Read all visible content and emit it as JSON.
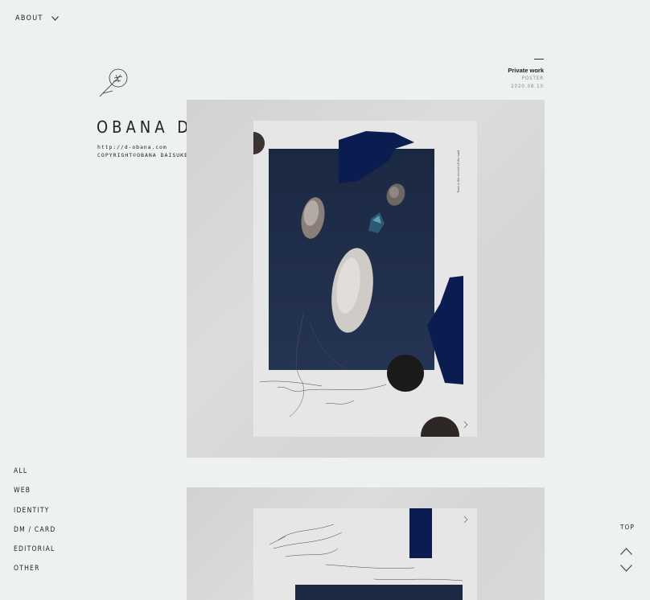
{
  "header": {
    "about_label": "ABOUT"
  },
  "profile": {
    "name": "OBANA DAISUKE",
    "url": "http://d-obana.com",
    "copyright": "COPYRIGHT©OBANA DAISUKE"
  },
  "work": {
    "title": "Private work",
    "category": "POSTER",
    "date": "2020.08.10"
  },
  "nav": {
    "items": [
      {
        "label": "ALL"
      },
      {
        "label": "WEB"
      },
      {
        "label": "IDENTITY"
      },
      {
        "label": "DM / CARD"
      },
      {
        "label": "EDITORIAL"
      },
      {
        "label": "OTHER"
      }
    ]
  },
  "scroll": {
    "top_label": "TOP"
  },
  "colors": {
    "background": "#eef1f2",
    "navy": "#0b1f4e",
    "dark_panel": "#1a2840"
  },
  "icons": {
    "about_chevron": "chevron-down-icon",
    "logo": "feather-logo-icon",
    "scroll_up": "chevron-up-icon",
    "scroll_down": "chevron-down-icon"
  }
}
